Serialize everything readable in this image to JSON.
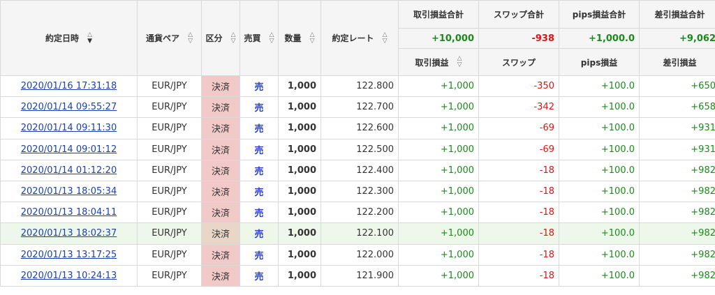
{
  "headers": {
    "date": "約定日時",
    "pair": "通貨ペア",
    "kubun": "区分",
    "baibai": "売買",
    "qty": "数量",
    "rate": "約定レート",
    "trade_pl": "取引損益",
    "swap": "スワップ",
    "pips_pl": "pips損益",
    "net_pl": "差引損益"
  },
  "totals": {
    "trade_pl_label": "取引損益合計",
    "swap_label": "スワップ合計",
    "pips_label": "pips損益合計",
    "net_label": "差引損益合計",
    "trade_pl": "+10,000",
    "swap": "-938",
    "pips": "+1,000.0",
    "net": "+9,062"
  },
  "sort_icons": {
    "up": "△",
    "down": "▽",
    "down_active": "▼"
  },
  "rows": [
    {
      "date": "2020/01/16 17:31:18",
      "pair": "EUR/JPY",
      "kubun": "決済",
      "side": "売",
      "qty": "1,000",
      "rate": "122.800",
      "trade": "+1,000",
      "swap": "-350",
      "pips": "+100.0",
      "net": "+650"
    },
    {
      "date": "2020/01/14 09:55:27",
      "pair": "EUR/JPY",
      "kubun": "決済",
      "side": "売",
      "qty": "1,000",
      "rate": "122.700",
      "trade": "+1,000",
      "swap": "-342",
      "pips": "+100.0",
      "net": "+658"
    },
    {
      "date": "2020/01/14 09:11:30",
      "pair": "EUR/JPY",
      "kubun": "決済",
      "side": "売",
      "qty": "1,000",
      "rate": "122.600",
      "trade": "+1,000",
      "swap": "-69",
      "pips": "+100.0",
      "net": "+931"
    },
    {
      "date": "2020/01/14 09:01:12",
      "pair": "EUR/JPY",
      "kubun": "決済",
      "side": "売",
      "qty": "1,000",
      "rate": "122.500",
      "trade": "+1,000",
      "swap": "-69",
      "pips": "+100.0",
      "net": "+931"
    },
    {
      "date": "2020/01/14 01:12:20",
      "pair": "EUR/JPY",
      "kubun": "決済",
      "side": "売",
      "qty": "1,000",
      "rate": "122.400",
      "trade": "+1,000",
      "swap": "-18",
      "pips": "+100.0",
      "net": "+982"
    },
    {
      "date": "2020/01/13 18:05:34",
      "pair": "EUR/JPY",
      "kubun": "決済",
      "side": "売",
      "qty": "1,000",
      "rate": "122.300",
      "trade": "+1,000",
      "swap": "-18",
      "pips": "+100.0",
      "net": "+982"
    },
    {
      "date": "2020/01/13 18:04:11",
      "pair": "EUR/JPY",
      "kubun": "決済",
      "side": "売",
      "qty": "1,000",
      "rate": "122.200",
      "trade": "+1,000",
      "swap": "-18",
      "pips": "+100.0",
      "net": "+982"
    },
    {
      "date": "2020/01/13 18:02:37",
      "pair": "EUR/JPY",
      "kubun": "決済",
      "side": "売",
      "qty": "1,000",
      "rate": "122.100",
      "trade": "+1,000",
      "swap": "-18",
      "pips": "+100.0",
      "net": "+982"
    },
    {
      "date": "2020/01/13 13:17:25",
      "pair": "EUR/JPY",
      "kubun": "決済",
      "side": "売",
      "qty": "1,000",
      "rate": "122.000",
      "trade": "+1,000",
      "swap": "-18",
      "pips": "+100.0",
      "net": "+982"
    },
    {
      "date": "2020/01/13 10:24:13",
      "pair": "EUR/JPY",
      "kubun": "決済",
      "side": "売",
      "qty": "1,000",
      "rate": "121.900",
      "trade": "+1,000",
      "swap": "-18",
      "pips": "+100.0",
      "net": "+982"
    }
  ],
  "highlight_row_index": 7,
  "colors": {
    "positive": "#1a8a1a",
    "negative": "#e01414",
    "link": "#1a3fb3",
    "kubun_bg": "#f2c9c9",
    "highlight_bg": "#eef8ea",
    "sell": "#2b3ec9"
  }
}
